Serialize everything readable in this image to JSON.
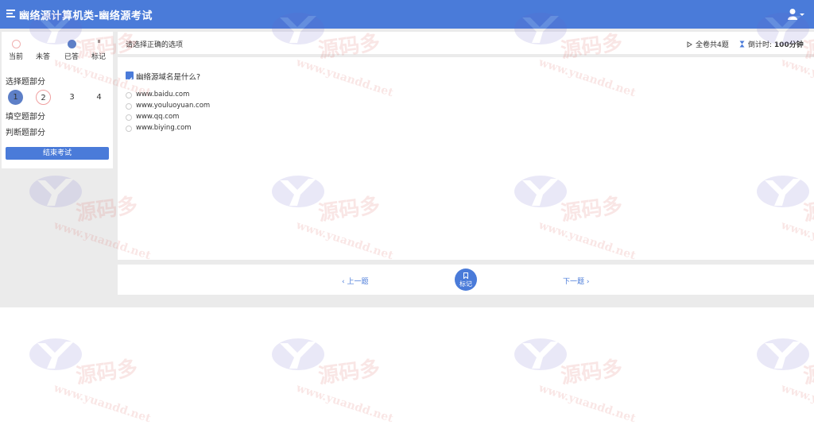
{
  "header": {
    "title": "幽络源计算机类-幽络源考试",
    "menu_icon": "menu-icon",
    "user_icon": "user-icon"
  },
  "legend": [
    {
      "label": "当前",
      "state": "current"
    },
    {
      "label": "未答",
      "state": "unanswered"
    },
    {
      "label": "已答",
      "state": "answered"
    },
    {
      "label": "标记",
      "state": "marked"
    }
  ],
  "sidebar": {
    "choice_section": "选择题部分",
    "fill_section": "填空题部分",
    "judge_section": "判断题部分",
    "question_numbers": [
      "1",
      "2",
      "3",
      "4"
    ],
    "finish_button": "结束考试"
  },
  "info_bar": {
    "instruction": "请选择正确的选项",
    "total": "全卷共4题",
    "timer_label": "倒计时:",
    "timer_value": "100分钟"
  },
  "question": {
    "text": "幽络源域名是什么?",
    "options": [
      "www.baidu.com",
      "www.youluoyuan.com",
      "www.qq.com",
      "www.biying.com"
    ]
  },
  "navigation": {
    "prev": "上一题",
    "mark": "标记",
    "next": "下一题"
  },
  "watermark": {
    "brand": "源码多",
    "url": "www.yuandd.net",
    "logo_icon": "yuandd-logo-icon"
  },
  "colors": {
    "primary": "#4a7bd9",
    "background": "#ebebeb",
    "watermark": "#d9534f"
  }
}
